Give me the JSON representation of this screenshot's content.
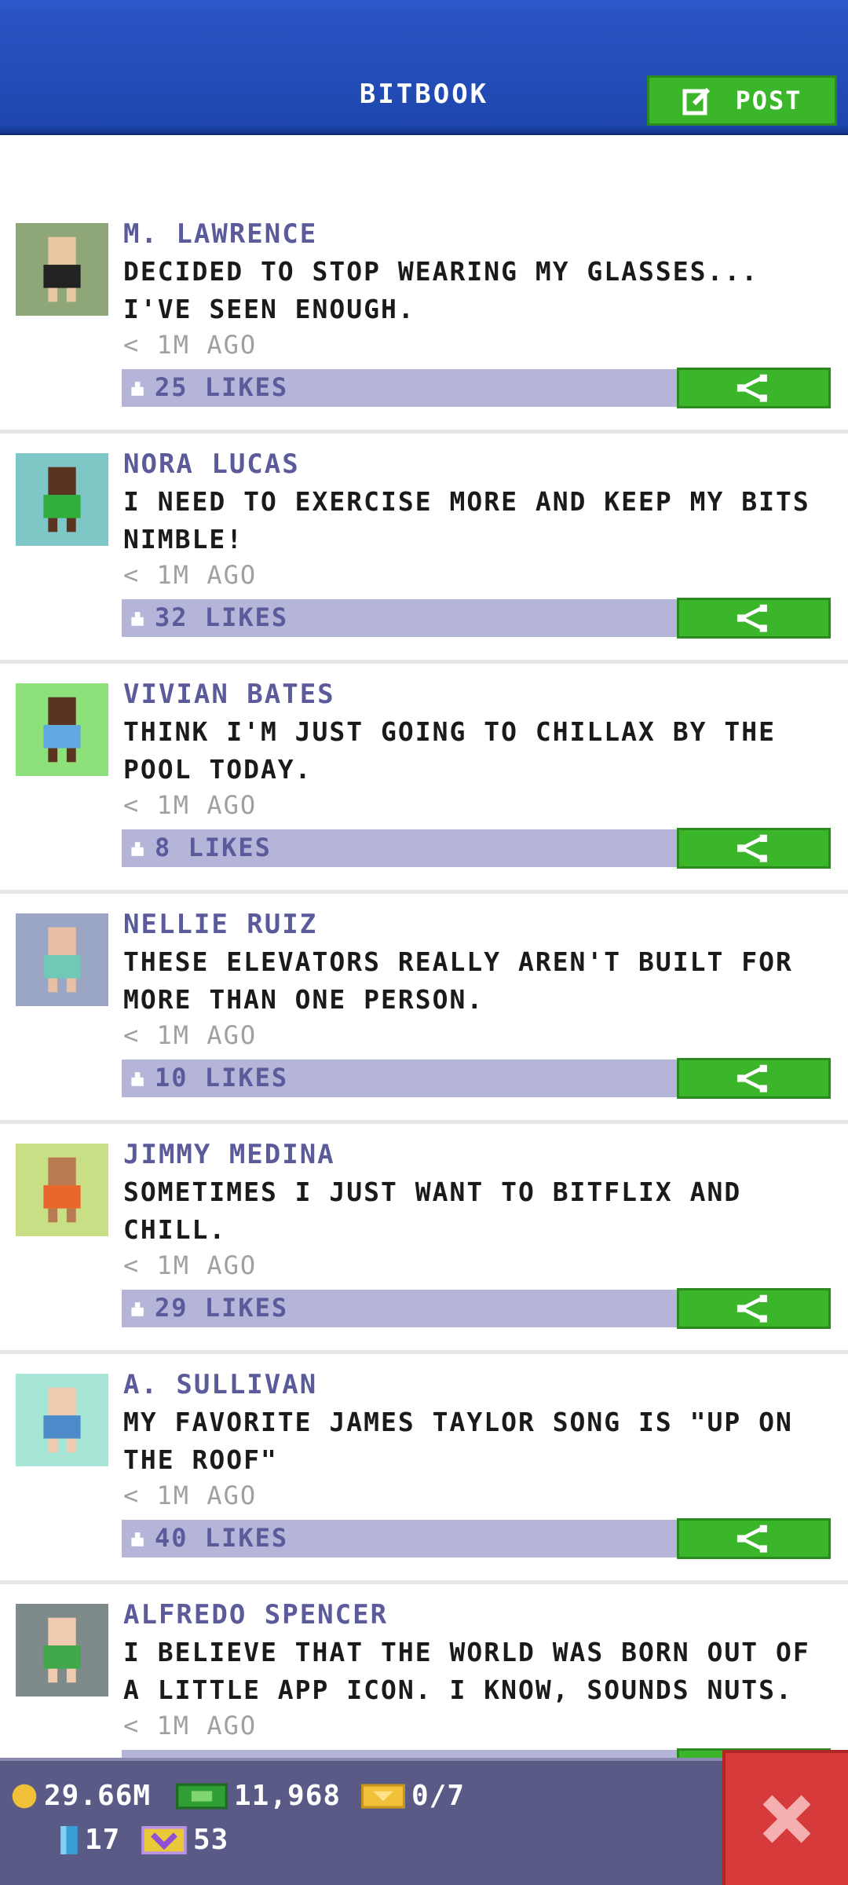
{
  "header": {
    "title": "BITBOOK",
    "post_label": "POST"
  },
  "posts": [
    {
      "name": "M. LAWRENCE",
      "text": "DECIDED TO STOP WEARING MY GLASSES... I'VE SEEN ENOUGH.",
      "time": "< 1M AGO",
      "likes": "25 LIKES",
      "avatar_bg": "#8fa778",
      "skin": "#e9c7a0",
      "shirt": "#222222"
    },
    {
      "name": "NORA LUCAS",
      "text": "I NEED TO EXERCISE MORE AND KEEP MY BITS NIMBLE!",
      "time": "< 1M AGO",
      "likes": "32 LIKES",
      "avatar_bg": "#7fc6c6",
      "skin": "#5a3420",
      "shirt": "#2fae3b"
    },
    {
      "name": "VIVIAN BATES",
      "text": "THINK I'M JUST GOING TO CHILLAX BY THE POOL TODAY.",
      "time": "< 1M AGO",
      "likes": "8 LIKES",
      "avatar_bg": "#8ee07b",
      "skin": "#5a3420",
      "shirt": "#5fa8e0"
    },
    {
      "name": "NELLIE RUIZ",
      "text": "THESE ELEVATORS REALLY AREN'T BUILT FOR MORE THAN ONE PERSON.",
      "time": "< 1M AGO",
      "likes": "10 LIKES",
      "avatar_bg": "#9aa6c3",
      "skin": "#e9bfa5",
      "shirt": "#6fc9b5"
    },
    {
      "name": "JIMMY MEDINA",
      "text": "SOMETIMES I JUST WANT TO BITFLIX AND CHILL.",
      "time": "< 1M AGO",
      "likes": "29 LIKES",
      "avatar_bg": "#c9df86",
      "skin": "#b87a50",
      "shirt": "#e8662b"
    },
    {
      "name": "A. SULLIVAN",
      "text": "MY FAVORITE JAMES TAYLOR SONG IS \"UP ON THE ROOF\"",
      "time": "< 1M AGO",
      "likes": "40 LIKES",
      "avatar_bg": "#a7e6d6",
      "skin": "#efcbb0",
      "shirt": "#4c8ac9"
    },
    {
      "name": "ALFREDO SPENCER",
      "text": "I BELIEVE THAT THE WORLD WAS BORN OUT OF A LITTLE APP ICON. I KNOW, SOUNDS NUTS.",
      "time": "< 1M AGO",
      "likes": "",
      "avatar_bg": "#7f8a8a",
      "skin": "#efcbb0",
      "shirt": "#3fa84a"
    }
  ],
  "stats": {
    "coins": "29.66M",
    "bux": "11,968",
    "tickets": "0/7",
    "gems": "17",
    "vip": "53"
  },
  "colors": {
    "accent_green": "#3bb52a",
    "header_blue": "#1e46ad",
    "name_purple": "#5b5a9a",
    "like_bar": "#b4b5d8",
    "bottom_bar": "#5a5a86",
    "close_red": "#d63a3a"
  },
  "icons": {
    "post": "compose-icon",
    "share": "share-icon",
    "like": "thumbs-up-icon",
    "close": "close-icon"
  }
}
